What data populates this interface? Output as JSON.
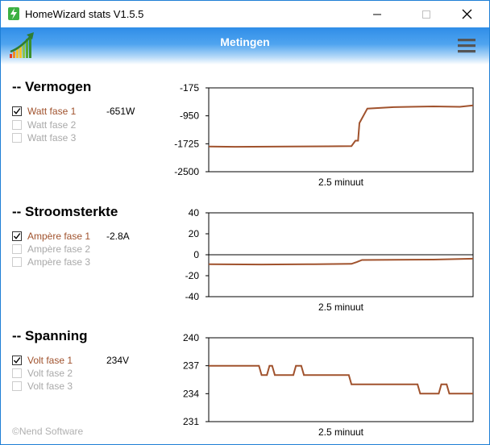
{
  "window": {
    "title": "HomeWizard stats V1.5.5"
  },
  "header": {
    "title": "Metingen",
    "menu_icon": "hamburger-menu-icon",
    "logo_icon": "bar-chart-arrow-logo"
  },
  "sections": [
    {
      "title": "-- Vermogen",
      "checks": [
        {
          "label": "Watt fase 1",
          "checked": true
        },
        {
          "label": "Watt fase 2",
          "checked": false
        },
        {
          "label": "Watt fase 3",
          "checked": false
        }
      ],
      "value": "-651W"
    },
    {
      "title": "-- Stroomsterkte",
      "checks": [
        {
          "label": "Ampère fase 1",
          "checked": true
        },
        {
          "label": "Ampère fase 2",
          "checked": false
        },
        {
          "label": "Ampère fase 3",
          "checked": false
        }
      ],
      "value": "-2.8A"
    },
    {
      "title": "-- Spanning",
      "checks": [
        {
          "label": "Volt fase 1",
          "checked": true
        },
        {
          "label": "Volt fase 2",
          "checked": false
        },
        {
          "label": "Volt fase 3",
          "checked": false
        }
      ],
      "value": "234V"
    }
  ],
  "footer": "©Nend Software",
  "colors": {
    "series": "#a0522d",
    "header": "#2f8de8"
  },
  "chart_data": [
    {
      "type": "line",
      "xlabel": "2.5 minuut",
      "yticks": [
        -175,
        -950,
        -1725,
        -2500
      ],
      "ylim": [
        -2500,
        -175
      ],
      "series": [
        {
          "values": [
            [
              0,
              -1800
            ],
            [
              0.1,
              -1810
            ],
            [
              0.3,
              -1800
            ],
            [
              0.45,
              -1795
            ],
            [
              0.54,
              -1790
            ],
            [
              0.555,
              -1640
            ],
            [
              0.565,
              -1640
            ],
            [
              0.57,
              -1150
            ],
            [
              0.6,
              -750
            ],
            [
              0.7,
              -710
            ],
            [
              0.85,
              -690
            ],
            [
              0.95,
              -700
            ],
            [
              1,
              -660
            ]
          ]
        }
      ]
    },
    {
      "type": "line",
      "xlabel": "2.5 minuut",
      "yticks": [
        40,
        20,
        0,
        -20,
        -40
      ],
      "ylim": [
        -40,
        40
      ],
      "series": [
        {
          "values": [
            [
              0,
              -9
            ],
            [
              0.2,
              -9.3
            ],
            [
              0.4,
              -9
            ],
            [
              0.54,
              -8.7
            ],
            [
              0.56,
              -7
            ],
            [
              0.58,
              -5
            ],
            [
              0.7,
              -4.8
            ],
            [
              0.85,
              -4.6
            ],
            [
              1,
              -3.8
            ]
          ]
        }
      ]
    },
    {
      "type": "line",
      "xlabel": "2.5 minuut",
      "yticks": [
        240,
        237,
        234,
        231
      ],
      "ylim": [
        231,
        240
      ],
      "series": [
        {
          "values": [
            [
              0,
              237
            ],
            [
              0.19,
              237
            ],
            [
              0.2,
              236
            ],
            [
              0.22,
              236
            ],
            [
              0.23,
              237
            ],
            [
              0.24,
              237
            ],
            [
              0.25,
              236
            ],
            [
              0.32,
              236
            ],
            [
              0.33,
              237
            ],
            [
              0.35,
              237
            ],
            [
              0.36,
              236
            ],
            [
              0.53,
              236
            ],
            [
              0.54,
              235
            ],
            [
              0.79,
              235
            ],
            [
              0.8,
              234
            ],
            [
              0.87,
              234
            ],
            [
              0.88,
              235
            ],
            [
              0.9,
              235
            ],
            [
              0.91,
              234
            ],
            [
              1,
              234
            ]
          ]
        }
      ]
    }
  ]
}
